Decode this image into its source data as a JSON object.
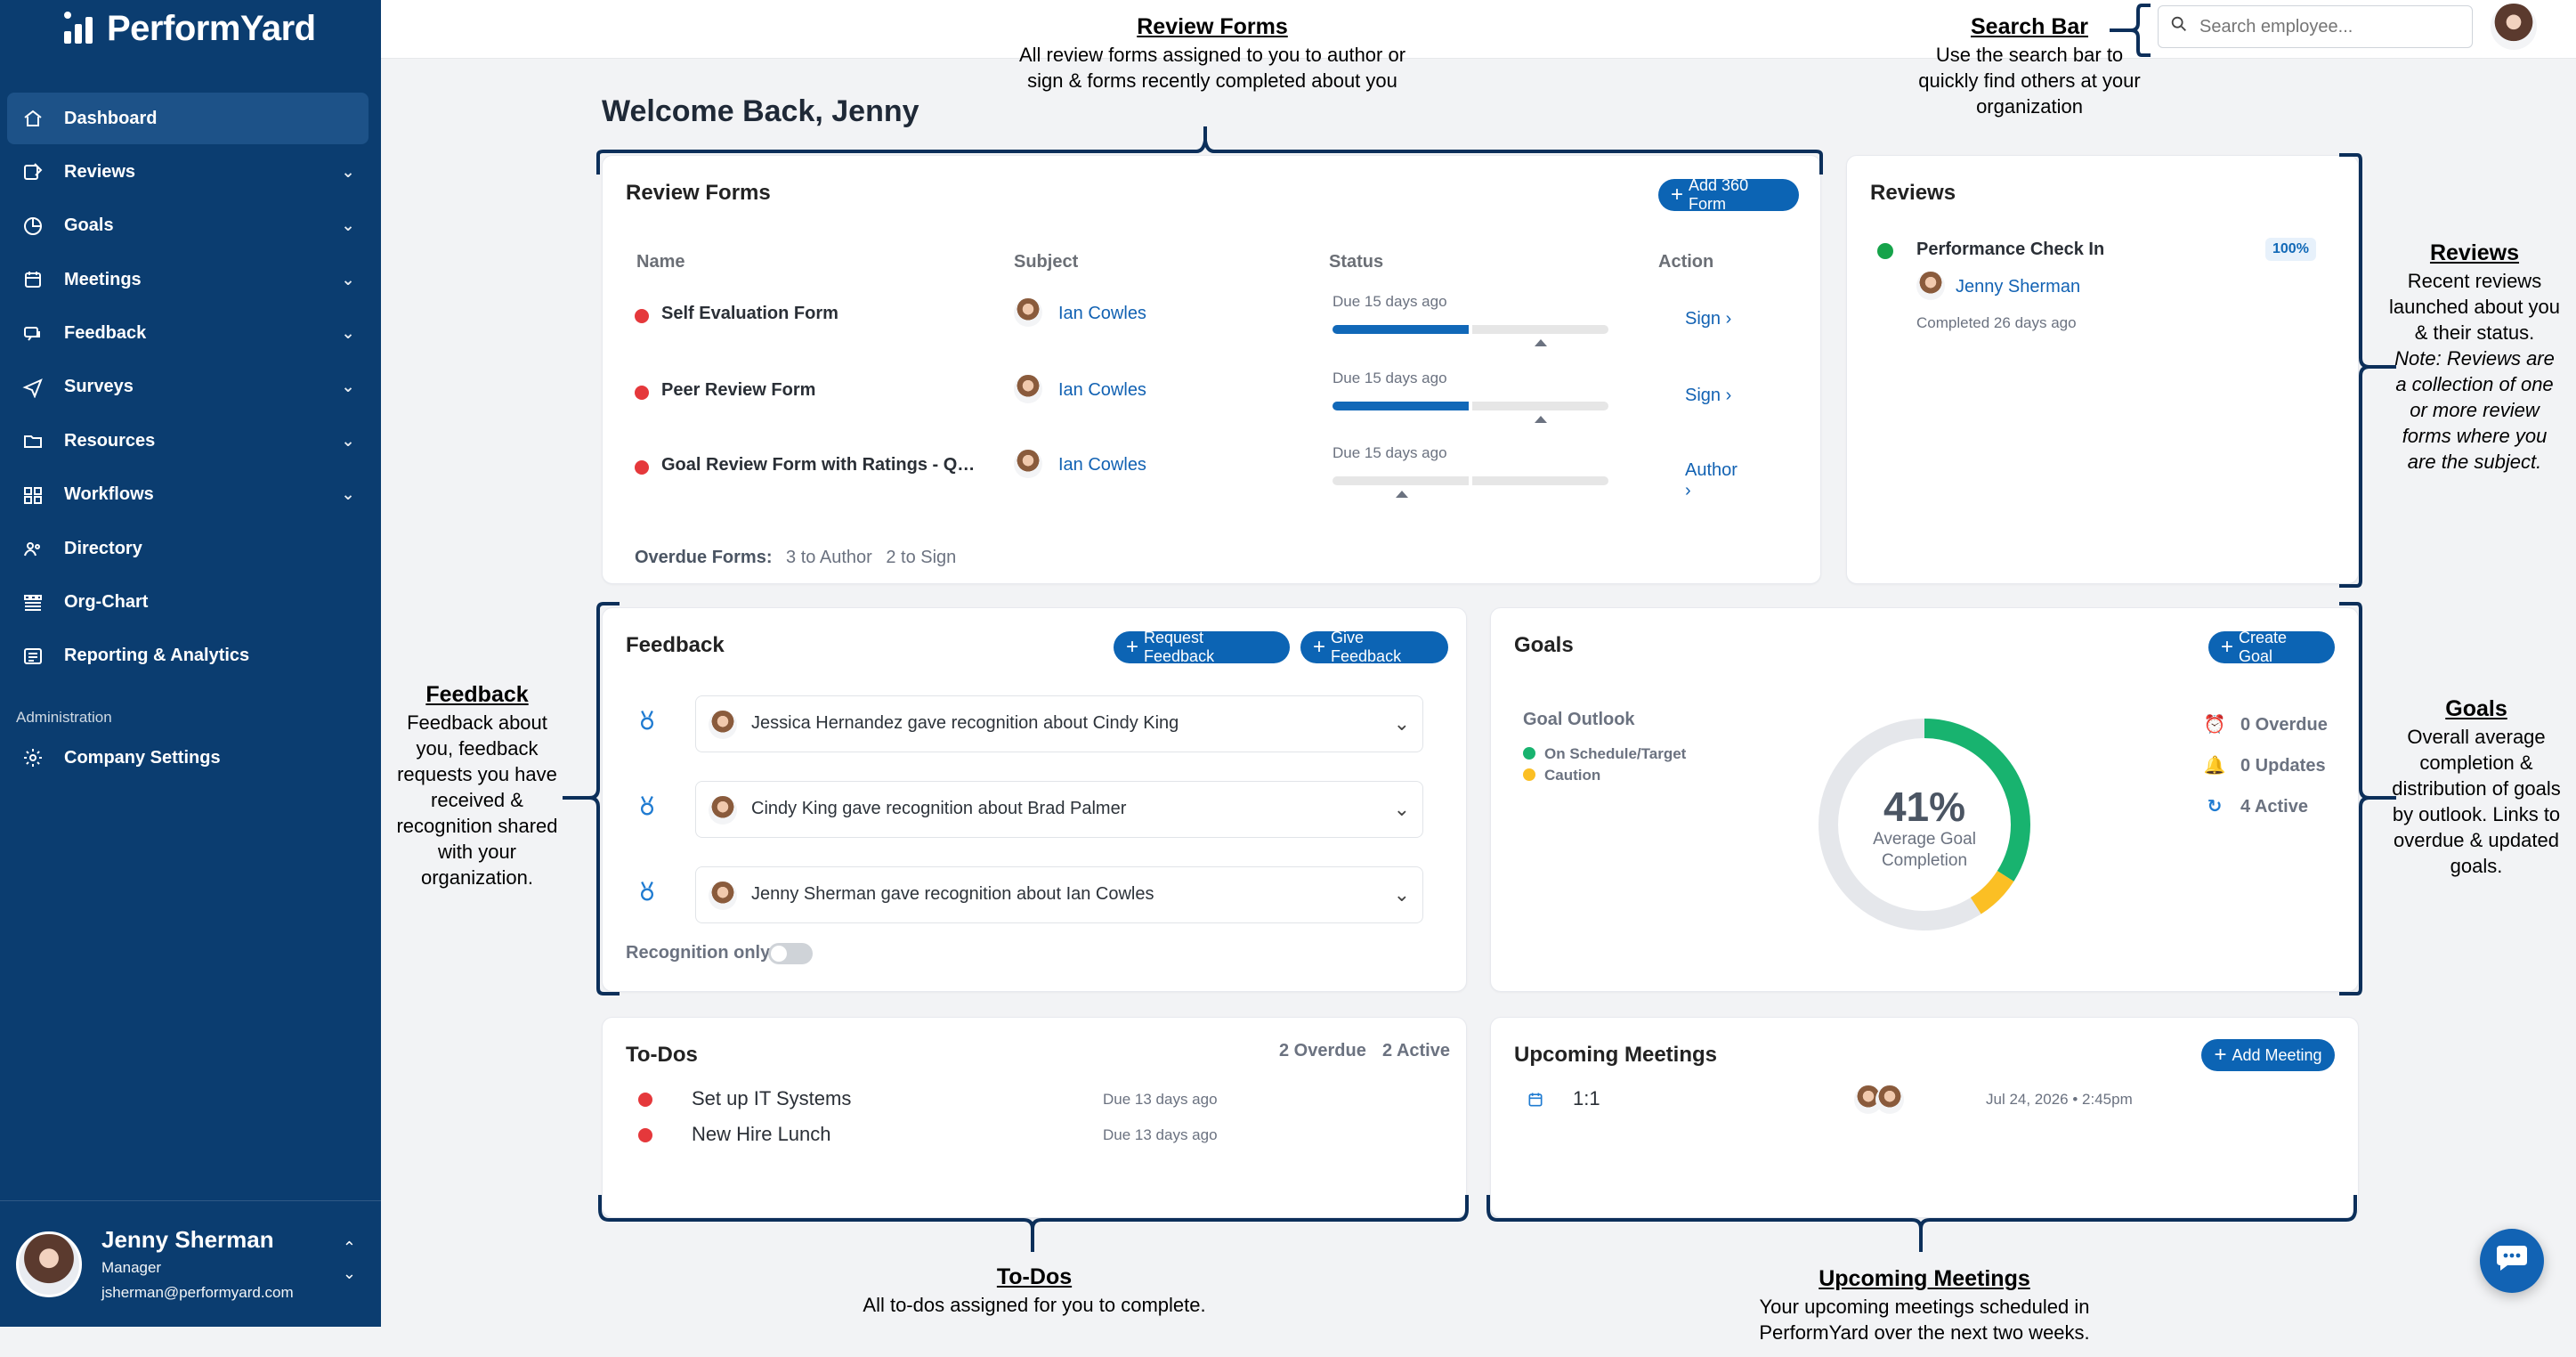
{
  "app": {
    "brand": "PerformYard"
  },
  "sidebar": {
    "items": [
      {
        "label": "Dashboard",
        "icon": "home-icon",
        "has_chevron": false,
        "active": true
      },
      {
        "label": "Reviews",
        "icon": "reviews-icon",
        "has_chevron": true
      },
      {
        "label": "Goals",
        "icon": "goals-icon",
        "has_chevron": true
      },
      {
        "label": "Meetings",
        "icon": "calendar-icon",
        "has_chevron": true
      },
      {
        "label": "Feedback",
        "icon": "chat-icon",
        "has_chevron": true
      },
      {
        "label": "Surveys",
        "icon": "send-icon",
        "has_chevron": true
      },
      {
        "label": "Resources",
        "icon": "folder-icon",
        "has_chevron": true
      },
      {
        "label": "Workflows",
        "icon": "grid-icon",
        "has_chevron": true
      },
      {
        "label": "Directory",
        "icon": "people-icon",
        "has_chevron": false
      },
      {
        "label": "Org-Chart",
        "icon": "org-chart-icon",
        "has_chevron": false
      },
      {
        "label": "Reporting & Analytics",
        "icon": "report-icon",
        "has_chevron": false
      }
    ],
    "admin_title": "Administration",
    "admin_item": {
      "label": "Company Settings",
      "icon": "gear-icon"
    },
    "user": {
      "name": "Jenny Sherman",
      "role": "Manager",
      "email": "jsherman@performyard.com"
    }
  },
  "topbar": {
    "search_placeholder": "Search employee..."
  },
  "welcome": "Welcome Back, Jenny",
  "review_forms": {
    "title": "Review Forms",
    "add_button": "Add 360 Form",
    "headers": {
      "name": "Name",
      "subject": "Subject",
      "status": "Status",
      "action": "Action"
    },
    "rows": [
      {
        "name": "Self Evaluation Form",
        "subject": "Ian Cowles",
        "due": "Due 15 days ago",
        "progress": 0.5,
        "action": "Sign"
      },
      {
        "name": "Peer Review Form",
        "subject": "Ian Cowles",
        "due": "Due 15 days ago",
        "progress": 0.5,
        "action": "Sign"
      },
      {
        "name": "Goal Review Form with Ratings - Qua…",
        "subject": "Ian Cowles",
        "due": "Due 15 days ago",
        "progress": 0.0,
        "action": "Author"
      }
    ],
    "overdue_label": "Overdue Forms:",
    "overdue_author": "3 to Author",
    "overdue_sign": "2 to Sign"
  },
  "reviews": {
    "title": "Reviews",
    "item": {
      "name": "Performance Check In",
      "percent": "100%",
      "person": "Jenny Sherman",
      "completed": "Completed 26 days ago"
    }
  },
  "feedback": {
    "title": "Feedback",
    "request_button": "Request Feedback",
    "give_button": "Give Feedback",
    "items": [
      "Jessica Hernandez gave recognition about Cindy King",
      "Cindy King gave recognition about Brad Palmer",
      "Jenny Sherman gave recognition about Ian Cowles"
    ],
    "toggle_label": "Recognition only"
  },
  "goals": {
    "title": "Goals",
    "create_button": "Create Goal",
    "outlook_title": "Goal Outlook",
    "legend": [
      {
        "label": "On Schedule/Target",
        "color": "#18b36f"
      },
      {
        "label": "Caution",
        "color": "#fbbf24"
      }
    ],
    "percent": "41%",
    "percent_label": "Average Goal Completion",
    "segments": {
      "on_track": 0.34,
      "caution": 0.07
    },
    "stats": [
      {
        "label": "0 Overdue",
        "icon": "alarm-icon"
      },
      {
        "label": "0 Updates",
        "icon": "bell-icon"
      },
      {
        "label": "4 Active",
        "icon": "history-icon"
      }
    ]
  },
  "todos": {
    "title": "To-Dos",
    "overdue": "2 Overdue",
    "active": "2 Active",
    "items": [
      {
        "label": "Set up IT Systems",
        "due": "Due 13 days ago"
      },
      {
        "label": "New Hire Lunch",
        "due": "Due 13 days ago"
      }
    ]
  },
  "meetings": {
    "title": "Upcoming Meetings",
    "add_button": "Add Meeting",
    "item": {
      "title": "1:1",
      "date": "Jul 24, 2026 • 2:45pm"
    }
  },
  "annotations": {
    "review_forms": {
      "title": "Review Forms",
      "text": "All review forms assigned to you to author or sign & forms recently completed about you"
    },
    "search": {
      "title": "Search Bar",
      "text": "Use the search bar to quickly find others at your organization"
    },
    "reviews": {
      "title": "Reviews",
      "text": "Recent reviews launched about you & their status.",
      "note": "Note: Reviews are a collection of one or more review forms where you are the subject."
    },
    "feedback": {
      "title": "Feedback",
      "text": "Feedback about you, feedback requests you have received & recognition shared with your organization."
    },
    "goals": {
      "title": "Goals",
      "text": "Overall average completion & distribution of goals by outlook. Links to overdue & updated goals."
    },
    "todos": {
      "title": "To-Dos",
      "text": "All to-dos assigned for you to complete."
    },
    "meetings": {
      "title": "Upcoming Meetings",
      "text": "Your upcoming meetings scheduled in PerformYard over the next two weeks."
    }
  }
}
